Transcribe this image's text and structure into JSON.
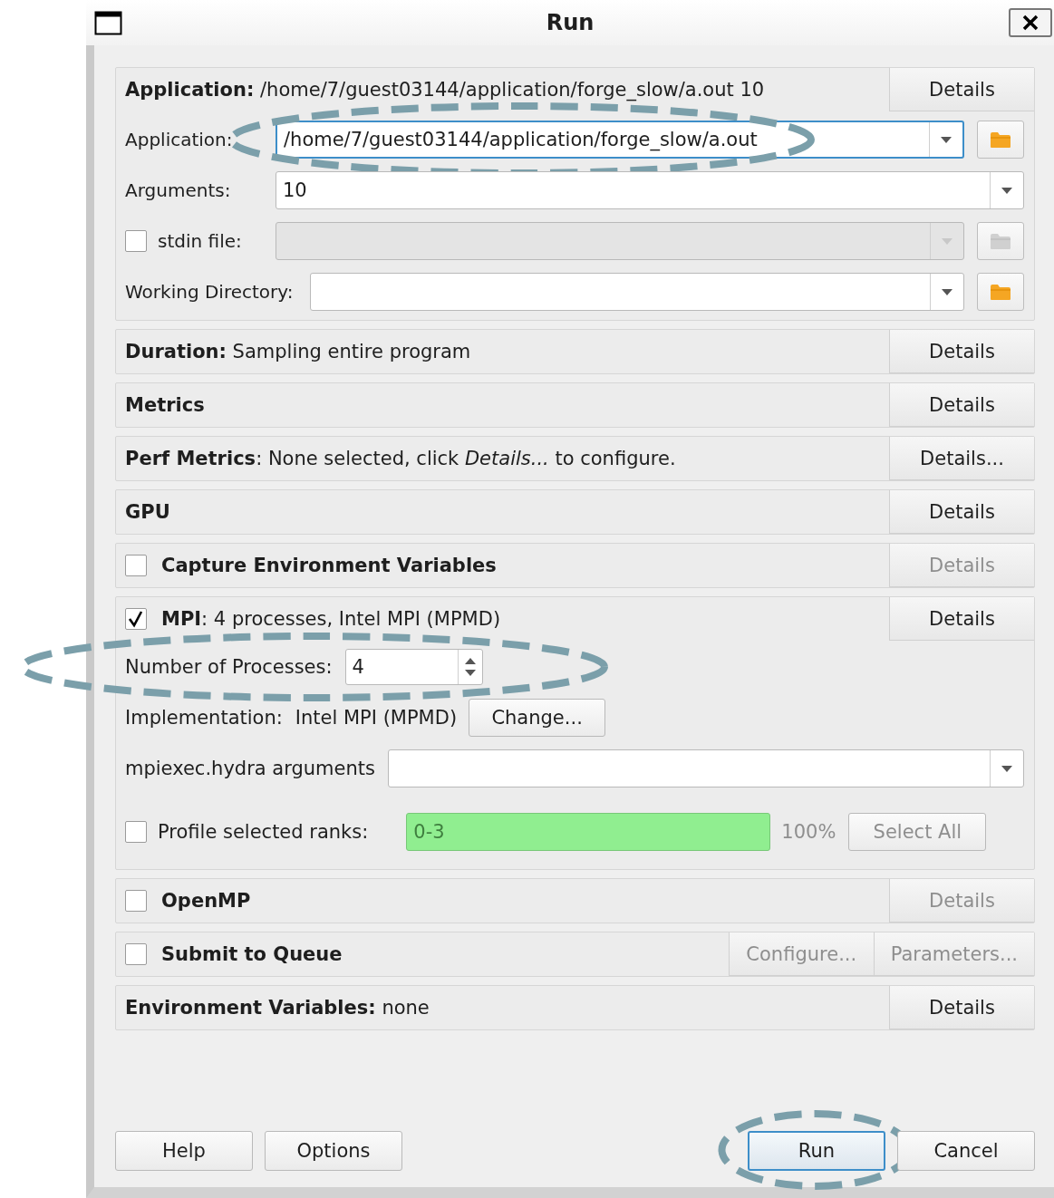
{
  "window": {
    "title": "Run"
  },
  "sections": [
    {
      "kind": "application",
      "text": "**Application:** /home/7/guest03144/application/forge_slow/a.out 10",
      "buttons": [
        {
          "label": "Details",
          "disabled": false
        }
      ],
      "rows": [
        {
          "label": "Application:",
          "value": "/home/7/guest03144/application/forge_slow/a.out",
          "focused": true,
          "disabled": false,
          "browse": true,
          "annotated": true
        },
        {
          "label": "Arguments:",
          "value": "10",
          "focused": false,
          "disabled": false,
          "browse": false,
          "annotated": false
        },
        {
          "label": "stdin file:",
          "checkbox": {
            "checked": false
          },
          "focused": false,
          "disabled": true,
          "browse": true,
          "annotated": false
        },
        {
          "label": "Working Directory:",
          "focused": false,
          "disabled": false,
          "browse": true,
          "annotated": false
        }
      ]
    },
    {
      "kind": "summary",
      "text": "**Duration:** Sampling entire program",
      "buttons": [
        {
          "label": "Details",
          "disabled": false
        }
      ]
    },
    {
      "kind": "summary",
      "heading": "Metrics",
      "buttons": [
        {
          "label": "Details",
          "disabled": false
        }
      ]
    },
    {
      "kind": "summary",
      "text": "**Perf Metrics**: None selected, click *Details...* to configure.",
      "buttons": [
        {
          "label": "Details...",
          "disabled": false
        }
      ]
    },
    {
      "kind": "summary",
      "heading": "GPU",
      "buttons": [
        {
          "label": "Details",
          "disabled": false
        }
      ]
    },
    {
      "kind": "option",
      "heading": "Capture Environment Variables",
      "checked": false,
      "buttons": [
        {
          "label": "Details",
          "disabled": true
        }
      ]
    },
    {
      "kind": "mpi",
      "checked": true,
      "text": "**MPI**: 4 processes, Intel MPI (MPMD)",
      "buttons": [
        {
          "label": "Details",
          "disabled": false
        }
      ],
      "processes": {
        "label": "Number of Processes:",
        "value": "4",
        "annotated": true
      },
      "implementation": {
        "label": "Implementation:",
        "value": "Intel MPI (MPMD)",
        "button": "Change..."
      },
      "arguments": {
        "label": "mpiexec.hydra arguments"
      },
      "ranks": {
        "label": "Profile selected ranks:",
        "checked": false,
        "value": "0-3",
        "valid": true,
        "disabled": true,
        "percent": "100%",
        "button": {
          "label": "Select All",
          "disabled": true
        }
      }
    },
    {
      "kind": "option",
      "heading": "OpenMP",
      "checked": false,
      "buttons": [
        {
          "label": "Details",
          "disabled": true
        }
      ]
    },
    {
      "kind": "option",
      "heading": "Submit to Queue",
      "checked": false,
      "buttons": [
        {
          "label": "Configure...",
          "disabled": true
        },
        {
          "label": "Parameters...",
          "disabled": true
        }
      ]
    },
    {
      "kind": "summary",
      "text": "**Environment Variables:** none",
      "buttons": [
        {
          "label": "Details",
          "disabled": false
        }
      ]
    }
  ],
  "footer": {
    "left": [
      {
        "label": "Help",
        "default": false
      },
      {
        "label": "Options",
        "default": false
      }
    ],
    "right": [
      {
        "label": "Run",
        "default": true,
        "annotated": true
      },
      {
        "label": "Cancel",
        "default": false
      }
    ]
  }
}
